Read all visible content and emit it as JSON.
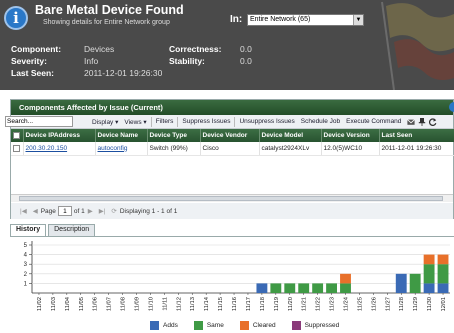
{
  "header": {
    "title": "Bare Metal Device Found",
    "subtitle": "Showing details for Entire Network group",
    "in_label": "In:",
    "scope_value": "Entire Network (65)",
    "fields": {
      "component_label": "Component:",
      "component_value": "Devices",
      "severity_label": "Severity:",
      "severity_value": "Info",
      "last_seen_label": "Last Seen:",
      "last_seen_value": "2011-12-01 19:26:30",
      "correctness_label": "Correctness:",
      "correctness_value": "0.0",
      "stability_label": "Stability:",
      "stability_value": "0.0"
    }
  },
  "panel": {
    "title": "Components Affected by Issue (Current)",
    "search_value": "Search...",
    "toolbar": {
      "display": "Display",
      "views": "Views",
      "filters": "Filters",
      "suppress": "Suppress Issues",
      "unsuppress": "Unsuppress Issues",
      "schedule": "Schedule Job",
      "execute": "Execute Command"
    },
    "columns": [
      "Device IPAddress",
      "Device Name",
      "Device Type",
      "Device Vendor",
      "Device Model",
      "Device Version",
      "Last Seen"
    ],
    "rows": [
      [
        "200.30.20.150",
        "autoconfig",
        "Switch (99%)",
        "Cisco",
        "catalyst2924XLv",
        "12.0(5)WC10",
        "2011-12-01 19:26:30"
      ]
    ],
    "pager": {
      "page_label": "Page",
      "page_value": "1",
      "of_label": "of 1",
      "display_text": "Displaying 1 - 1 of 1"
    }
  },
  "tabs": [
    "History",
    "Description"
  ],
  "colors": {
    "adds": "#3a6ab5",
    "same": "#3f9a45",
    "cleared": "#e8702a",
    "suppressed": "#8a3a7a"
  },
  "chart_data": {
    "type": "bar",
    "stacked": true,
    "categories": [
      "11/02",
      "11/03",
      "11/04",
      "11/05",
      "11/06",
      "11/07",
      "11/08",
      "11/09",
      "11/10",
      "11/11",
      "11/12",
      "11/13",
      "11/14",
      "11/15",
      "11/16",
      "11/17",
      "11/18",
      "11/19",
      "11/20",
      "11/21",
      "11/22",
      "11/23",
      "11/24",
      "11/25",
      "11/26",
      "11/27",
      "11/28",
      "11/29",
      "11/30",
      "12/01"
    ],
    "series": [
      {
        "name": "Adds",
        "values": [
          0,
          0,
          0,
          0,
          0,
          0,
          0,
          0,
          0,
          0,
          0,
          0,
          0,
          0,
          0,
          0,
          1,
          0,
          0,
          0,
          0,
          0,
          0,
          0,
          0,
          0,
          2,
          0,
          1,
          1
        ]
      },
      {
        "name": "Same",
        "values": [
          0,
          0,
          0,
          0,
          0,
          0,
          0,
          0,
          0,
          0,
          0,
          0,
          0,
          0,
          0,
          0,
          0,
          1,
          1,
          1,
          1,
          1,
          1,
          0,
          0,
          0,
          0,
          2,
          2,
          2
        ]
      },
      {
        "name": "Cleared",
        "values": [
          0,
          0,
          0,
          0,
          0,
          0,
          0,
          0,
          0,
          0,
          0,
          0,
          0,
          0,
          0,
          0,
          0,
          0,
          0,
          0,
          0,
          0,
          1,
          0,
          0,
          0,
          0,
          0,
          1,
          1
        ]
      },
      {
        "name": "Suppressed",
        "values": [
          0,
          0,
          0,
          0,
          0,
          0,
          0,
          0,
          0,
          0,
          0,
          0,
          0,
          0,
          0,
          0,
          0,
          0,
          0,
          0,
          0,
          0,
          0,
          0,
          0,
          0,
          0,
          0,
          0,
          0
        ]
      }
    ],
    "yticks": [
      "1",
      "2",
      "3",
      "4",
      "5"
    ],
    "ylim": [
      0,
      5
    ],
    "grid": true,
    "legend": "bottom"
  }
}
